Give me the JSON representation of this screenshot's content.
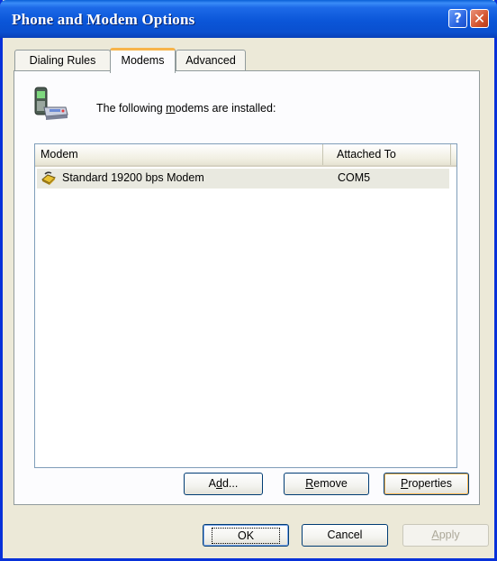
{
  "window": {
    "title": "Phone and Modem Options"
  },
  "titlebar_buttons": {
    "help": "?",
    "close": "✕"
  },
  "tabs": [
    {
      "label": "Dialing Rules",
      "active": false
    },
    {
      "label": "Modems",
      "active": true
    },
    {
      "label": "Advanced",
      "active": false
    }
  ],
  "intro": {
    "pre": "The following ",
    "accel": "m",
    "post": "odems are  installed:"
  },
  "list": {
    "columns": [
      "Modem",
      "Attached To"
    ],
    "rows": [
      {
        "modem": "Standard 19200 bps Modem",
        "attached_to": "COM5"
      }
    ]
  },
  "buttons": {
    "add": {
      "pre": "A",
      "accel": "d",
      "post": "d..."
    },
    "remove": {
      "pre": "",
      "accel": "R",
      "post": "emove"
    },
    "properties": {
      "pre": "",
      "accel": "P",
      "post": "roperties"
    },
    "ok": "OK",
    "cancel": "Cancel",
    "apply": {
      "pre": "",
      "accel": "A",
      "post": "pply"
    }
  },
  "icons": {
    "modem": "modem-phone-icon",
    "row": "modem-device-icon"
  },
  "colors": {
    "titlebar": "#0b56d8",
    "dialog_bg": "#ece9d8",
    "active_tab_accent": "#f7b44a",
    "selected_row": "#e9e9e0"
  }
}
